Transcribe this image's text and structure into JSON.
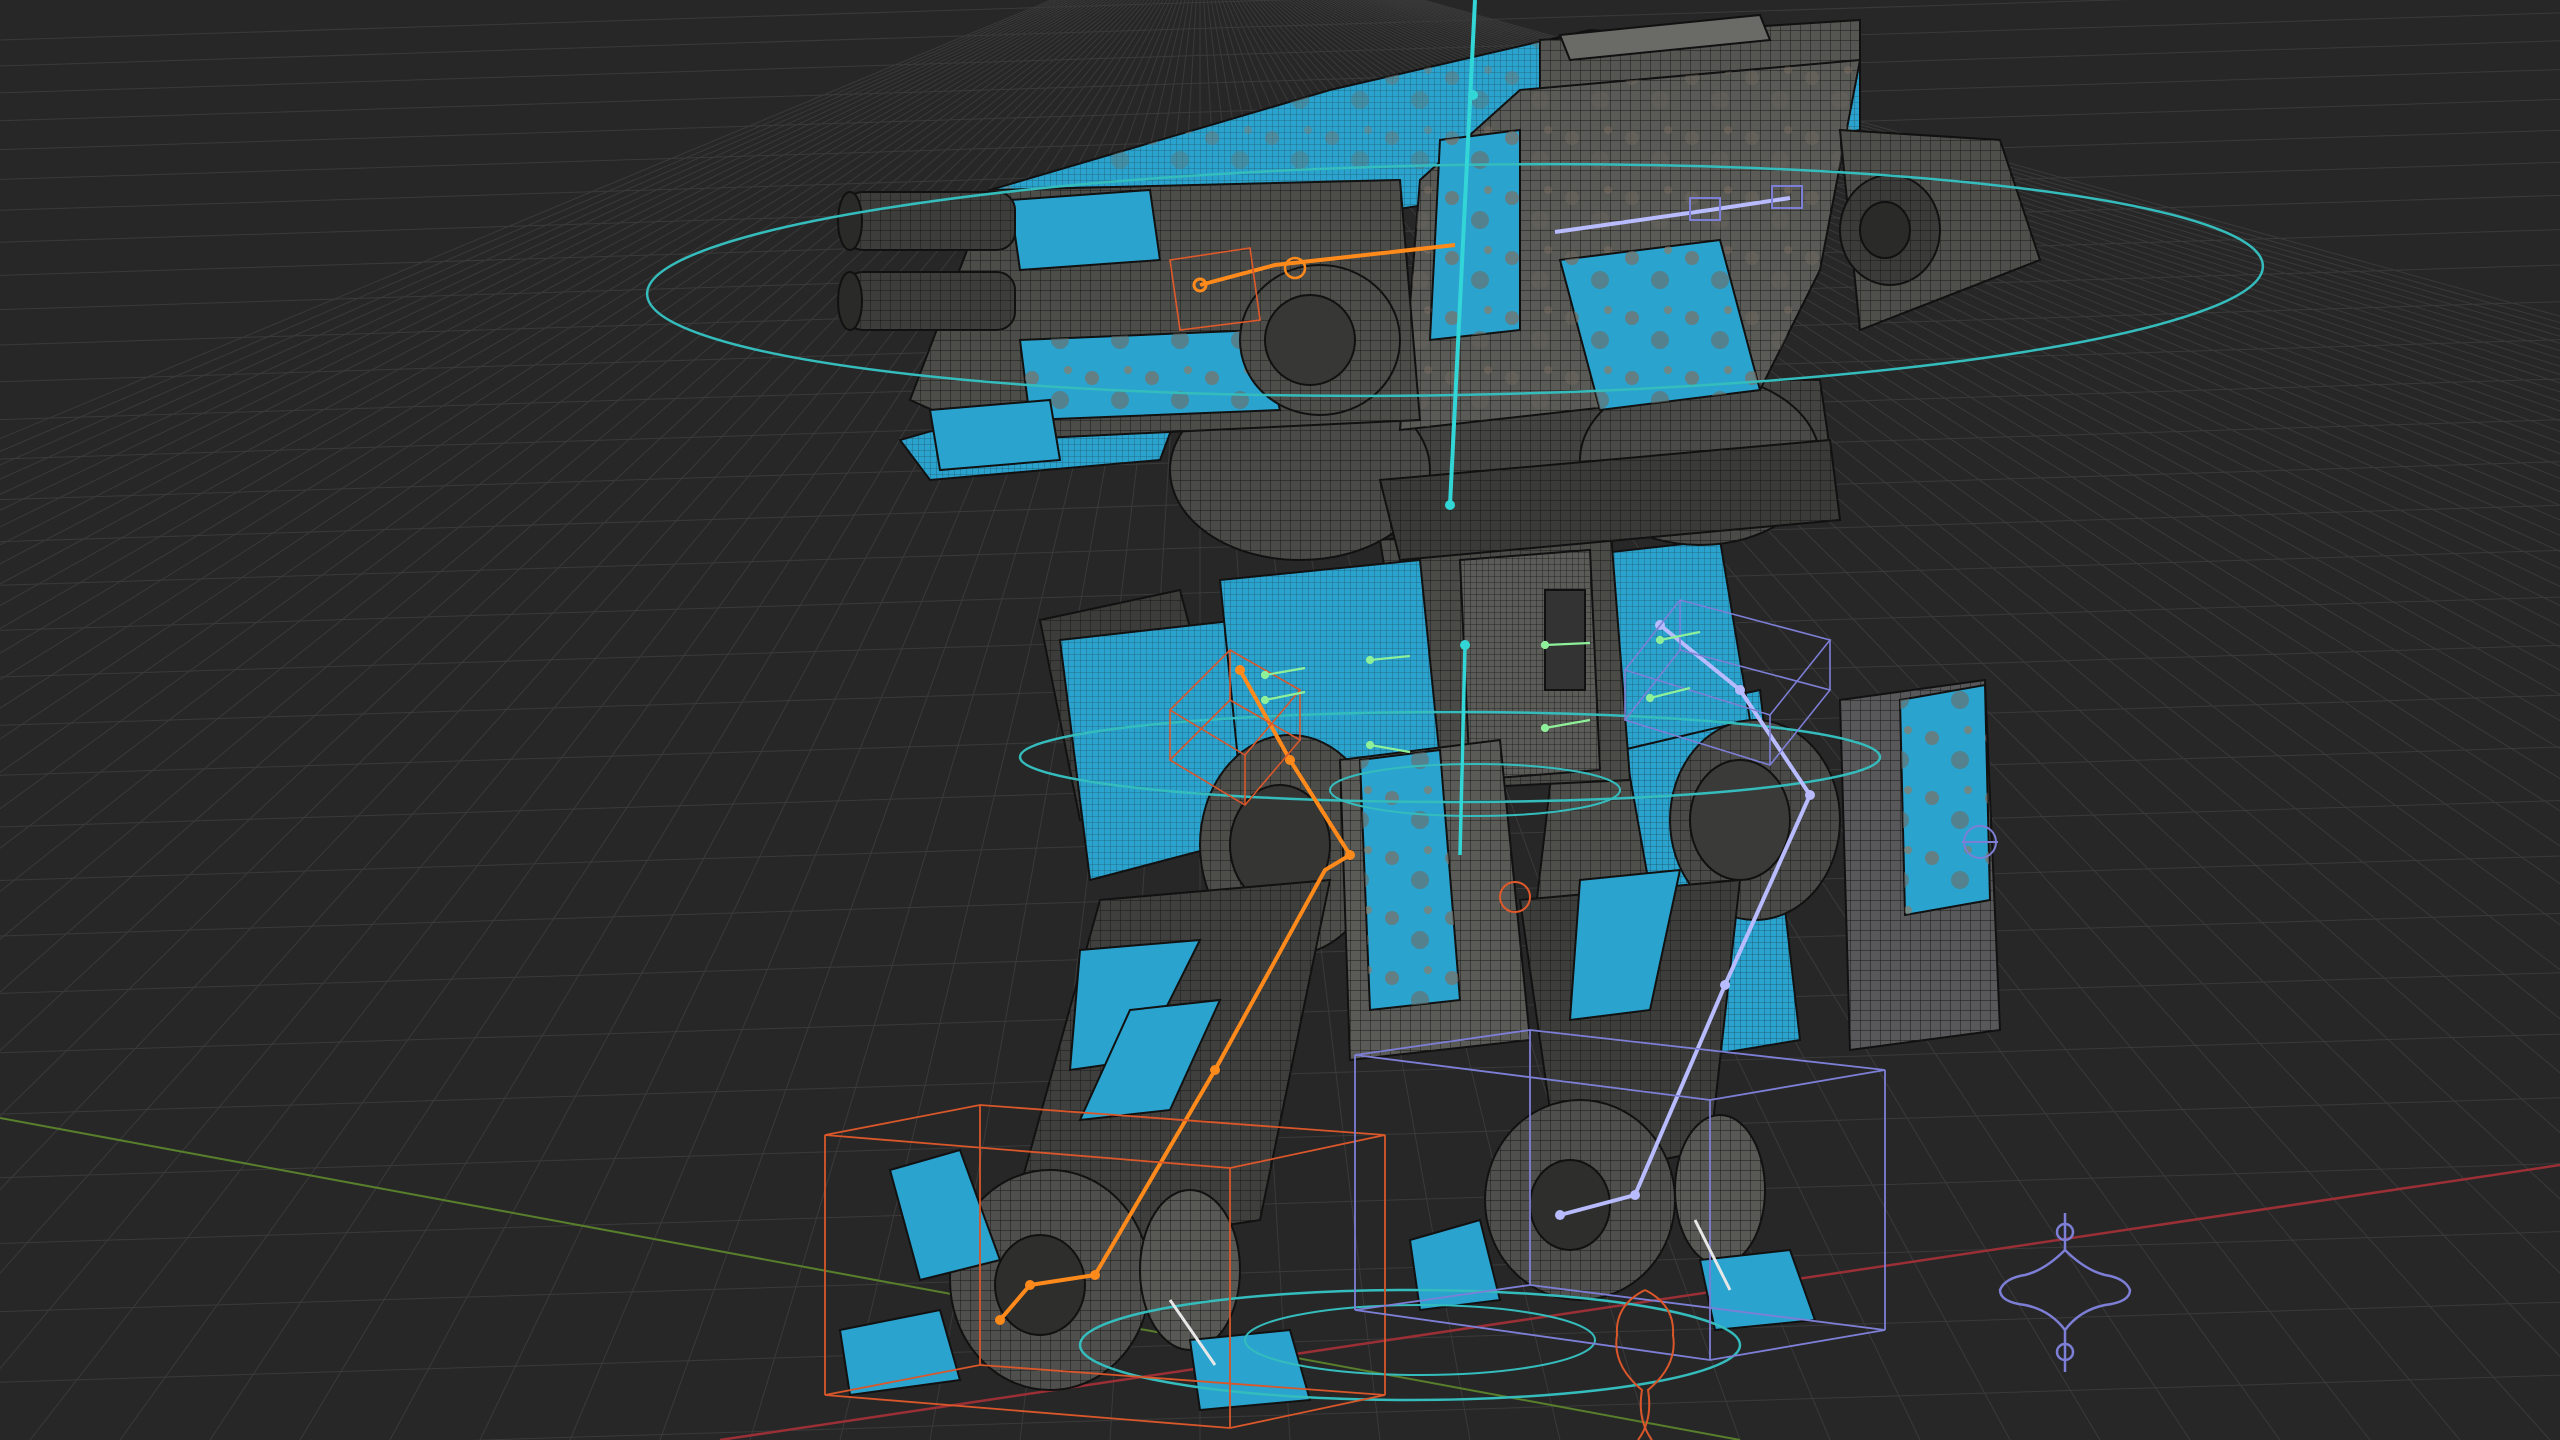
{
  "viewport": {
    "background": "#272727",
    "grid_color": "#3a3a3a",
    "x_axis_color": "#a8323a",
    "y_axis_color": "#5e8a2c"
  },
  "model": {
    "armor_color": "#2aa3cf",
    "armor_shade_color": "#1a7aa3",
    "metal_color": "#5b5b58",
    "metal_dark_color": "#3c3c3a",
    "wire_color": "#141414",
    "rust_color": "#8e7458"
  },
  "rig": {
    "left_leg_color": "#ff8a1c",
    "right_leg_color": "#b8bcff",
    "spine_color": "#32d0d0",
    "control_ring_color": "#3ac7c7",
    "ik_box_left_color": "#e0592a",
    "ik_box_right_color": "#7d7fd6",
    "small_bone_color": "#8ff09a"
  },
  "icons": {
    "empty_target": "crosshair-empty-icon",
    "camera": "camera-icon",
    "light": "light-icon"
  }
}
